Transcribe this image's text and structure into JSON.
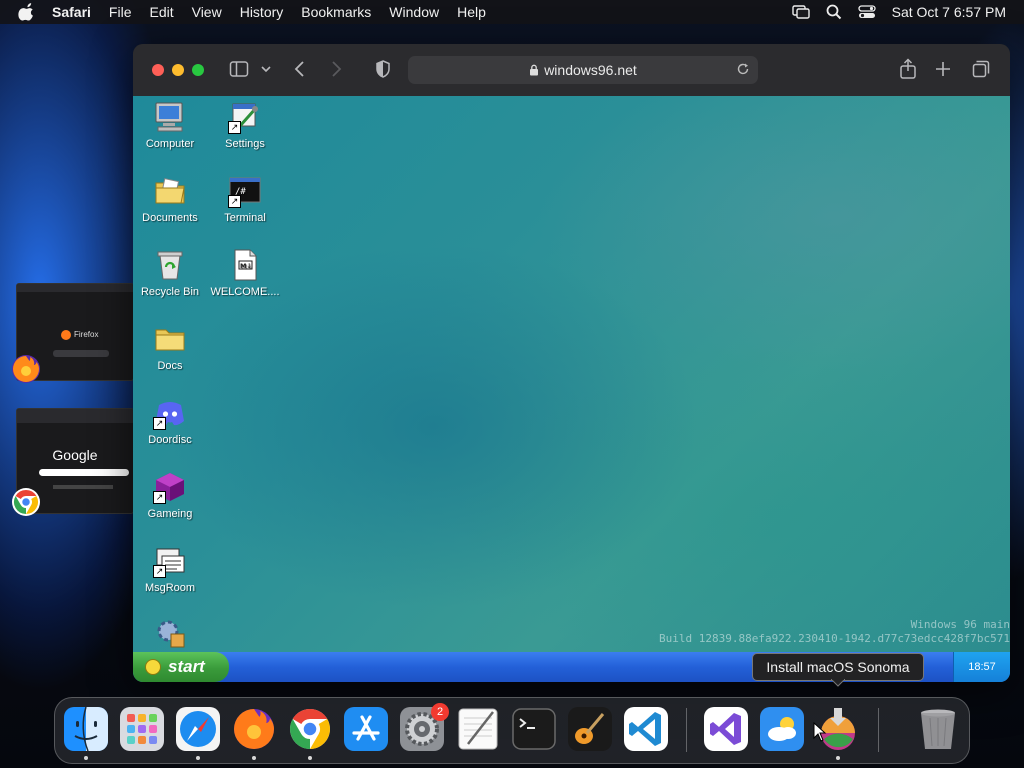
{
  "menubar": {
    "app_name": "Safari",
    "items": [
      "File",
      "Edit",
      "View",
      "History",
      "Bookmarks",
      "Window",
      "Help"
    ],
    "datetime": "Sat Oct 7  6:57 PM"
  },
  "browser": {
    "url": "windows96.net"
  },
  "desktop": {
    "icons": [
      {
        "label": "Computer"
      },
      {
        "label": "Settings"
      },
      {
        "label": "Documents"
      },
      {
        "label": "Terminal"
      },
      {
        "label": "Recycle Bin"
      },
      {
        "label": "WELCOME...."
      },
      {
        "label": "Docs"
      },
      {
        "label": "Doordisc"
      },
      {
        "label": "Gameing"
      },
      {
        "label": "MsgRoom"
      }
    ],
    "build_line1": "Windows 96 main",
    "build_line2": "Build 12839.88efa922.230410-1942.d77c73edcc428f7bc571",
    "start_label": "start",
    "clock": "18:57"
  },
  "thumbnails": {
    "firefox_label": "Firefox",
    "google_label": "Google"
  },
  "tooltip": "Install macOS Sonoma",
  "dock": {
    "settings_badge": "2"
  }
}
